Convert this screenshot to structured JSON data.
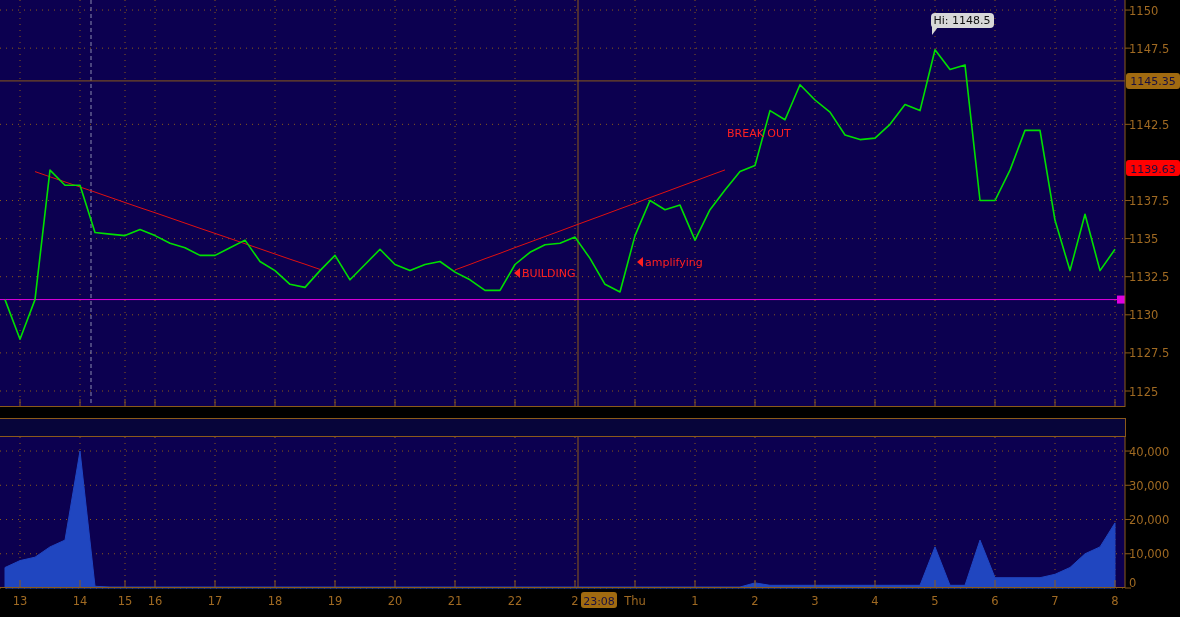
{
  "price_panel": {
    "chart_data": {
      "type": "line",
      "grid": true,
      "ylim": [
        1123.95,
        1150.66
      ],
      "yticks": [
        {
          "value": 1125,
          "label": "1125"
        },
        {
          "value": 1127.5,
          "label": "1127.5"
        },
        {
          "value": 1130,
          "label": "1130"
        },
        {
          "value": 1132.5,
          "label": "1132.5"
        },
        {
          "value": 1135,
          "label": "1135"
        },
        {
          "value": 1137.5,
          "label": "1137.5"
        },
        {
          "value": 1142.5,
          "label": "1142.5"
        },
        {
          "value": 1147.5,
          "label": "1147.5"
        },
        {
          "value": 1150,
          "label": "1150"
        }
      ],
      "categories": [
        null,
        null,
        null,
        null,
        null,
        null,
        null,
        null,
        null,
        null,
        null,
        null,
        null,
        null,
        null,
        null,
        null,
        null,
        null,
        null,
        null,
        null,
        null,
        null,
        null,
        null,
        null,
        null,
        null,
        null,
        null,
        null,
        null,
        null,
        null,
        null,
        null,
        null,
        null,
        null,
        null,
        null,
        null,
        null,
        null,
        null,
        null,
        null,
        null,
        null,
        null,
        null,
        null,
        null,
        null,
        null,
        null,
        null,
        null,
        null,
        null,
        null,
        null,
        null,
        null,
        null,
        null,
        null,
        null,
        null,
        null,
        null,
        null,
        null,
        null
      ],
      "series": [
        {
          "color": "#00e000",
          "values": [
            1131.0,
            1128.4,
            1131.0,
            1139.5,
            1138.5,
            1138.5,
            1135.4,
            1135.3,
            1135.2,
            1135.6,
            1135.2,
            1134.7,
            1134.4,
            1133.9,
            1133.9,
            1134.4,
            1134.9,
            1133.5,
            1132.9,
            1132.0,
            1131.8,
            1132.9,
            1133.9,
            1132.3,
            1133.3,
            1134.3,
            1133.3,
            1132.9,
            1133.3,
            1133.5,
            1132.8,
            1132.3,
            1131.6,
            1131.6,
            1133.3,
            1134.1,
            1134.6,
            1134.7,
            1135.1,
            1133.7,
            1132.0,
            1131.5,
            1135.2,
            1137.5,
            1136.9,
            1137.2,
            1134.9,
            1136.9,
            1138.2,
            1139.4,
            1139.8,
            1143.4,
            1142.8,
            1145.1,
            1144.1,
            1143.3,
            1141.8,
            1141.5,
            1141.6,
            1142.5,
            1143.8,
            1143.4,
            1147.4,
            1146.1,
            1146.4,
            1137.5,
            1137.5,
            1139.5,
            1142.1,
            1142.1,
            1136.2,
            1132.9,
            1136.6,
            1132.9,
            1134.3
          ]
        },
        {
          "color": "#e01010",
          "values": [
            null,
            null,
            1139.4,
            1139.06,
            1138.72,
            1138.39,
            1138.05,
            1137.71,
            1137.37,
            1137.03,
            1136.7,
            1136.36,
            1136.02,
            1135.68,
            1135.34,
            1135.01,
            1134.67,
            1134.33,
            1133.99,
            1133.65,
            1133.32,
            1132.98,
            null,
            null,
            null,
            null,
            null,
            null,
            null,
            null,
            1132.95,
            1133.31,
            1133.68,
            1134.04,
            1134.41,
            1134.77,
            1135.14,
            1135.5,
            1135.87,
            1136.23,
            1136.59,
            1136.96,
            1137.32,
            1137.69,
            1138.05,
            1138.42,
            1138.78,
            1139.15,
            1139.51,
            null,
            null,
            null,
            null,
            null,
            null,
            null,
            null,
            null,
            null,
            null,
            null,
            null,
            null,
            null,
            null,
            null,
            null,
            null,
            null,
            null,
            null,
            null,
            null,
            null,
            null
          ]
        }
      ],
      "ref_lines": [
        {
          "axis": "y",
          "value": 1145.35,
          "label": "1145.35"
        },
        {
          "axis": "y",
          "value": 1131.0
        }
      ],
      "annotations": [
        "BUILDING",
        "amplifying",
        "BREAK OUT",
        "Hi: 1148.5"
      ]
    },
    "last_price": "1139.63"
  },
  "volume_panel": {
    "chart_data": {
      "type": "area",
      "grid": true,
      "ylim": [
        0,
        44100
      ],
      "yticks": [
        {
          "value": 0,
          "label": "0"
        },
        {
          "value": 10000,
          "label": "10,000"
        },
        {
          "value": 20000,
          "label": "20,000"
        },
        {
          "value": 30000,
          "label": "30,000"
        },
        {
          "value": 40000,
          "label": "40,000"
        }
      ],
      "categories": [
        null,
        "13",
        null,
        null,
        null,
        "14",
        null,
        null,
        "15",
        null,
        "16",
        null,
        null,
        null,
        "17",
        null,
        null,
        null,
        "18",
        null,
        null,
        null,
        "19",
        null,
        null,
        null,
        "20",
        null,
        null,
        null,
        "21",
        null,
        null,
        null,
        "22",
        null,
        null,
        null,
        "2",
        null,
        null,
        null,
        "Thu",
        null,
        null,
        null,
        "1",
        null,
        null,
        null,
        "2",
        null,
        null,
        null,
        "3",
        null,
        null,
        null,
        "4",
        null,
        null,
        null,
        "5",
        null,
        null,
        null,
        "6",
        null,
        null,
        null,
        "7",
        null,
        null,
        null,
        "8"
      ],
      "series": [
        {
          "color": "#2046c0",
          "values": [
            6000,
            8000,
            9000,
            12000,
            14000,
            40000,
            500,
            300,
            300,
            300,
            300,
            300,
            300,
            300,
            300,
            300,
            300,
            300,
            300,
            300,
            300,
            300,
            300,
            300,
            300,
            300,
            300,
            300,
            300,
            300,
            300,
            300,
            300,
            300,
            300,
            300,
            300,
            300,
            300,
            300,
            300,
            300,
            300,
            300,
            300,
            300,
            300,
            300,
            300,
            300,
            1500,
            800,
            800,
            800,
            800,
            800,
            800,
            800,
            800,
            800,
            800,
            800,
            12000,
            800,
            800,
            14000,
            3000,
            3000,
            3000,
            3000,
            4000,
            6000,
            10000,
            12000,
            19000
          ]
        }
      ]
    },
    "crosshair_time": "23:08"
  }
}
